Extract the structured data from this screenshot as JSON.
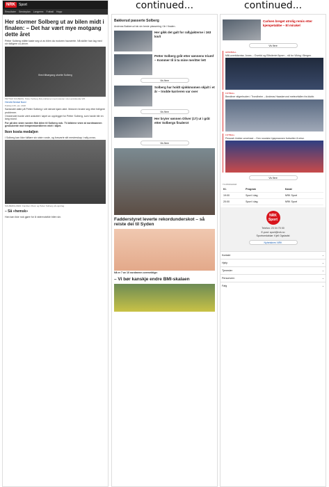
{
  "continued": "continued...",
  "header": {
    "logo": "NRK",
    "section": "Sport",
    "nav": [
      "Resultater",
      "Sendeplan",
      "Langrenn",
      "Fotball",
      "Hopp"
    ]
  },
  "article": {
    "title": "Her stormer Solberg ut av bilen midt i finalen: – Det har vært mye motgang dette året",
    "lead": "Petter Solberg måtte kaste seg ut av bilen da motoren havarerte. Nå skiller han lag med sin tidligere co-driver.",
    "video_label": "Bred tilbørgang utsette Solberg",
    "photo_caption": "PETTER SOLBERG: Petter Solberg fikk problemer med motoren i den avsluttende VM.",
    "byline": "Henrik Berdal Nord",
    "published": "Publisert 05. okt. 2018",
    "p1": "Sørlandet dalte på Petter Solberg i sitt niende kjøre-stint. Motoren brukte seg etter tidligere problemer.",
    "p2": "Omstendet burde vært avsluttet i løpet av opplegget for Petter Solberg, som harde blir en lang stund.",
    "p3": "For på den siste runden fikk bilen til Solberg nok. TV-bildene viste at nordmannen geskubente mot temperaturnåleren midt i løpet.",
    "section_head": "Ikon kosta medaljen",
    "p4": "I Solberg kan ikke fullføre sin siste runde, og forsvarte sitt mesterskap i rally-cross.",
    "family_caption": "SOLBERGLIDEN: Familien Oliver og Petter Solberg på oppdrag.",
    "quote_head": "– Så «hemsk»",
    "p5": "Han kan ikke nok gjøre for å videreutvikle bilen sin."
  },
  "col2": {
    "section": "Bakkerud passerte Solberg",
    "p1": "Andreas Bakkerud tok sin beste plassering i år i finalen.",
    "cards": [
      {
        "title": "Her gikk det galt for rallyjakterne i 163 km/t"
      },
      {
        "title": "Petter Solberg gråt etter sønnens triumf – Kommer til å ta mine meritter lett"
      },
      {
        "title": "Solberg har holdt sjokkmomen skjult i et år – trodde karrieren var over"
      },
      {
        "title": "Her bryter sønnen Oliver (17) ut i gråt etter Solbergs finalerot"
      }
    ],
    "more": "Vis flere",
    "big_title": "Fadderstyret leverte rekordunderskot – så reiste dei til Syden",
    "bmi_title": "– Vi bør kanskje endre BMI-skalaen",
    "bmi_kicker": "Nå er 7 av 10 nordmenn overvektige:"
  },
  "col3": {
    "top_title": "Carlsen breget utrolig remis etter kjempetabbe – El mirakel",
    "more": "Vis flere",
    "feed": [
      {
        "kicker": "HÅNDBALL",
        "text": "Mål-overtidsmiss Jones – Overtid og Elitsiteriet åpner – nå for Viking i Bergen."
      },
      {
        "kicker": "FOTBALL",
        "text": "Bendtner stigerbuden i Trondheim – Andreas Haaskerund meteorfallen fra klubb."
      },
      {
        "kicker": "FOTBALL",
        "text": "Pessrah klokke umerbast – Den russiske kjøpmannen fortsetter å reise."
      }
    ],
    "table": {
      "title": "TV-PROGRAM",
      "headers": [
        "Kl.",
        "Program",
        "Kanal"
      ],
      "rows": [
        [
          "19:00",
          "Sport i dag",
          "NRK Sport"
        ],
        [
          "20:00",
          "Sport i dag",
          "NRK Sport"
        ]
      ]
    },
    "footer_logo": "NRK Sport",
    "footer_lines": [
      "Telefon: 23 04 70 00",
      "E-post: sport@nrk.no",
      "Sportsredaktør: Kjell Ogstadst"
    ],
    "footer_btn": "Nyhetsbrev NRK",
    "footer_nav": [
      "Kontakt",
      "Hjelp",
      "Tjenester",
      "Personvern",
      "Følg"
    ]
  }
}
